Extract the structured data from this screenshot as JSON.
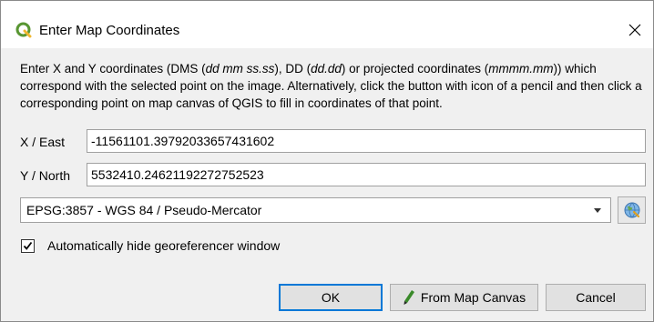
{
  "window": {
    "title": "Enter Map Coordinates",
    "close_icon": "close-icon",
    "app_icon": "qgis-logo-icon"
  },
  "description": {
    "part1": "Enter X and Y coordinates (DMS (",
    "dms_format": "dd mm ss.ss",
    "part2": "), DD (",
    "dd_format": "dd.dd",
    "part3": ") or projected coordinates (",
    "proj_format": "mmmm.mm",
    "part4": ")) which correspond with the selected point on the image. Alternatively, click the button with icon of a pencil and then click a corresponding point on map canvas of QGIS to fill in coordinates of that point."
  },
  "x_field": {
    "label": "X / East",
    "value": "-11561101.39792033657431602"
  },
  "y_field": {
    "label": "Y / North",
    "value": "5532410.24621192272752523"
  },
  "crs": {
    "selected": "EPSG:3857 - WGS 84 / Pseudo-Mercator",
    "button_icon": "globe-crs-icon"
  },
  "auto_hide": {
    "label": "Automatically hide georeferencer window",
    "checked": true
  },
  "buttons": {
    "ok": "OK",
    "from_map_canvas": "From Map Canvas",
    "cancel": "Cancel"
  },
  "colors": {
    "accent": "#0078d7",
    "qgis_green": "#589632",
    "qgis_yellow": "#f0b72f"
  }
}
